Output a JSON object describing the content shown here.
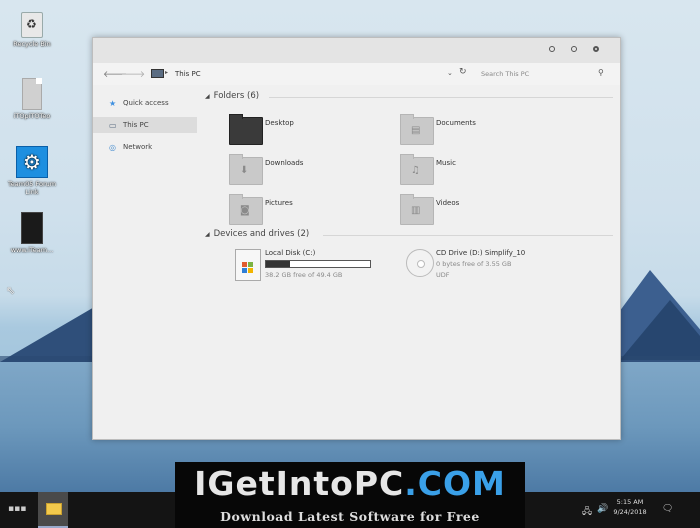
{
  "desktop": {
    "icons": [
      {
        "label": "Recycle Bin"
      },
      {
        "label": "iTOpiTOTeo"
      },
      {
        "label": "Team05 Forum Link"
      },
      {
        "label": "www.iTeam..."
      }
    ]
  },
  "explorer": {
    "breadcrumb": "This PC",
    "search_placeholder": "Search This PC",
    "sidebar": [
      {
        "label": "Quick access",
        "icon": "star-icon"
      },
      {
        "label": "This PC",
        "icon": "computer-icon",
        "selected": true
      },
      {
        "label": "Network",
        "icon": "network-icon"
      }
    ],
    "folders_header": "Folders (6)",
    "folders": [
      {
        "name": "Desktop"
      },
      {
        "name": "Documents"
      },
      {
        "name": "Downloads"
      },
      {
        "name": "Music"
      },
      {
        "name": "Pictures"
      },
      {
        "name": "Videos"
      }
    ],
    "drives_header": "Devices and drives (2)",
    "drives": [
      {
        "name": "Local Disk (C:)",
        "free": "38.2 GB free of 49.4 GB",
        "used_fraction": 0.23
      },
      {
        "name": "CD Drive (D:) Simplify_10",
        "free": "0 bytes free of 3.55 GB",
        "fs": "UDF"
      }
    ]
  },
  "banner": {
    "title_a": "IGetIntoPC",
    "title_b": ".COM",
    "subtitle": "Download Latest Software for Free"
  },
  "taskbar": {
    "time": "5:15 AM",
    "date": "9/24/2018"
  }
}
